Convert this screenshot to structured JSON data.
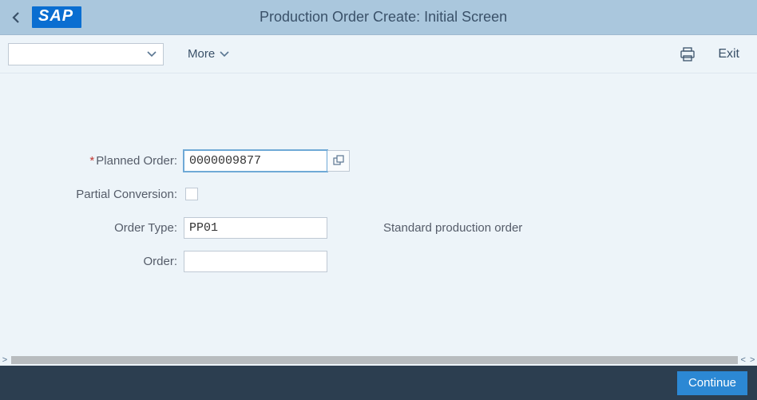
{
  "header": {
    "logo": "SAP",
    "title": "Production Order Create: Initial Screen"
  },
  "toolbar": {
    "more_label": "More",
    "exit_label": "Exit"
  },
  "form": {
    "planned_order": {
      "label": "Planned Order:",
      "value": "0000009877"
    },
    "partial_conversion": {
      "label": "Partial Conversion:",
      "checked": false
    },
    "order_type": {
      "label": "Order Type:",
      "value": "PP01",
      "description": "Standard production order"
    },
    "order": {
      "label": "Order:",
      "value": ""
    }
  },
  "footer": {
    "continue_label": "Continue"
  }
}
